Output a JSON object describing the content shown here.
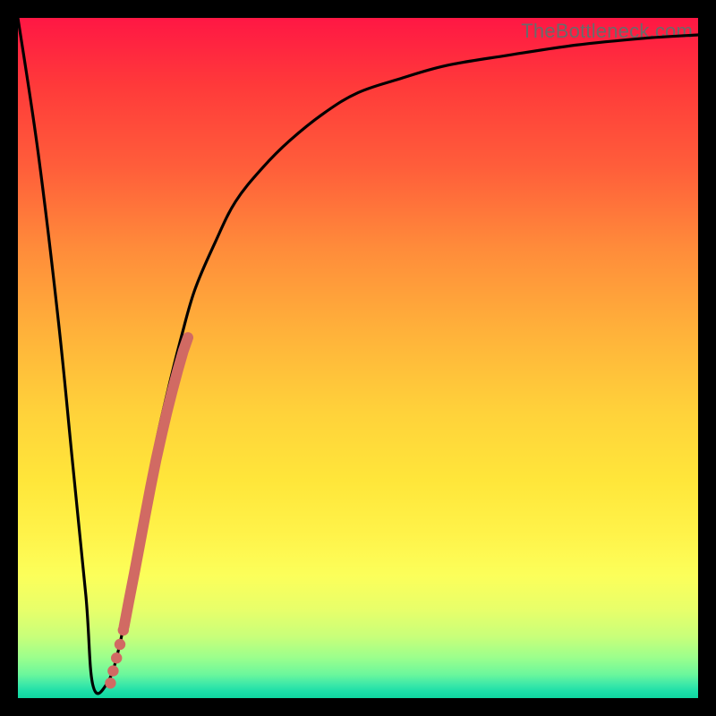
{
  "watermark": "TheBottleneck.com",
  "chart_data": {
    "type": "line",
    "title": "",
    "xlabel": "",
    "ylabel": "",
    "xlim": [
      0,
      100
    ],
    "ylim": [
      0,
      100
    ],
    "grid": false,
    "legend": false,
    "series": [
      {
        "name": "main-curve",
        "color": "#000000",
        "x": [
          0,
          3,
          6,
          8,
          10,
          11,
          13,
          15,
          18,
          20,
          22,
          24,
          26,
          29,
          32,
          36,
          40,
          45,
          50,
          56,
          63,
          72,
          82,
          92,
          100
        ],
        "y": [
          100,
          80,
          55,
          35,
          15,
          2,
          2,
          8,
          24,
          36,
          45,
          53,
          60,
          67,
          73,
          78,
          82,
          86,
          89,
          91,
          93,
          94.5,
          96,
          97,
          97.5
        ]
      }
    ],
    "highlight_segment": {
      "name": "highlighted-range",
      "color": "#d16a63",
      "x": [
        15.6,
        16.3,
        17.1,
        17.9,
        18.7,
        19.5,
        20.3,
        21.1,
        21.9,
        22.7,
        23.5,
        24.3,
        25.0
      ],
      "y": [
        10.5,
        14.2,
        18.3,
        22.5,
        26.8,
        31.0,
        35.0,
        38.6,
        42.0,
        45.2,
        48.2,
        51.0,
        53.0
      ]
    },
    "points": {
      "name": "dots",
      "color": "#d16a63",
      "x": [
        13.6,
        14.0,
        14.5,
        15.0,
        15.5
      ],
      "y": [
        2.2,
        4.0,
        5.9,
        7.9,
        10.0
      ]
    }
  }
}
